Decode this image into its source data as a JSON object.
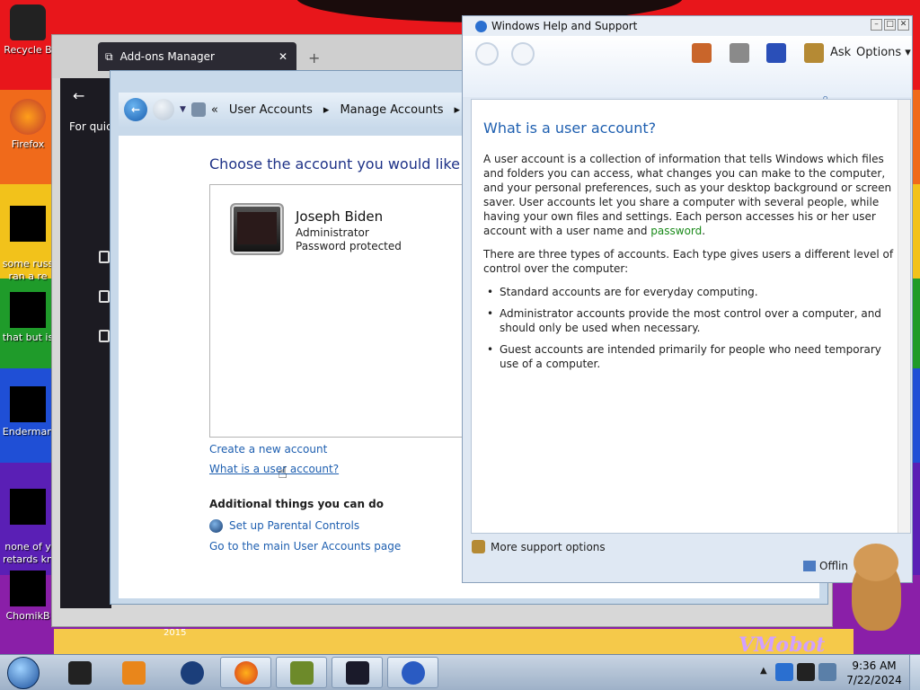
{
  "desktop": {
    "icons": [
      {
        "label": "Recycle B"
      },
      {
        "label": "Firefox"
      },
      {
        "label": "some russ\nran a re"
      },
      {
        "label": "that but is"
      },
      {
        "label": "Enderman"
      },
      {
        "label": "none of y\nretards kn"
      },
      {
        "label": "ChomikB"
      }
    ],
    "year_text": "2015",
    "vmobot_text": "VMobot"
  },
  "firefox": {
    "tab_title": "Add-ons Manager",
    "close_glyph": "✕",
    "new_tab_glyph": "+",
    "back_glyph": "←",
    "quick_text": "For quick"
  },
  "user_accounts": {
    "breadcrumb_sep": "«",
    "crumb1": "User Accounts",
    "crumb_arrow1": "▸",
    "crumb2": "Manage Accounts",
    "crumb_arrow2": "▸",
    "heading": "Choose the account you would like to cha",
    "account": {
      "name": "Joseph Biden",
      "role": "Administrator",
      "password_status": "Password protected"
    },
    "links": {
      "create": "Create a new account",
      "what_is": "What is a user account?",
      "additional_heading": "Additional things you can do",
      "parental": "Set up Parental Controls",
      "main_page": "Go to the main User Accounts page"
    }
  },
  "help": {
    "window_title": "Windows Help and Support",
    "toolbar": {
      "ask": "Ask",
      "options": "Options ▾"
    },
    "heading": "What is a user account?",
    "para1": "A user account is a collection of information that tells Windows which files and folders you can access, what changes you can make to the computer, and your personal preferences, such as your desktop background or screen saver. User accounts let you share a computer with several people, while having your own files and settings. Each person accesses his or her user account with a user name and ",
    "para1_link": "password",
    "para1_end": ".",
    "para2": "There are three types of accounts. Each type gives users a different level of control over the computer:",
    "bullets": [
      "Standard accounts are for everyday computing.",
      "Administrator accounts provide the most control over a computer, and should only be used when necessary.",
      "Guest accounts are intended primarily for people who need temporary use of a computer."
    ],
    "more_support": "More support options",
    "offline": "Offlin"
  },
  "taskbar": {
    "time": "9:36 AM",
    "date": "7/22/2024",
    "tray_arrow": "▲"
  },
  "colors": {
    "link_blue": "#1e5fb0",
    "heading_blue": "#1e3287",
    "green_link": "#1a8a1a"
  }
}
